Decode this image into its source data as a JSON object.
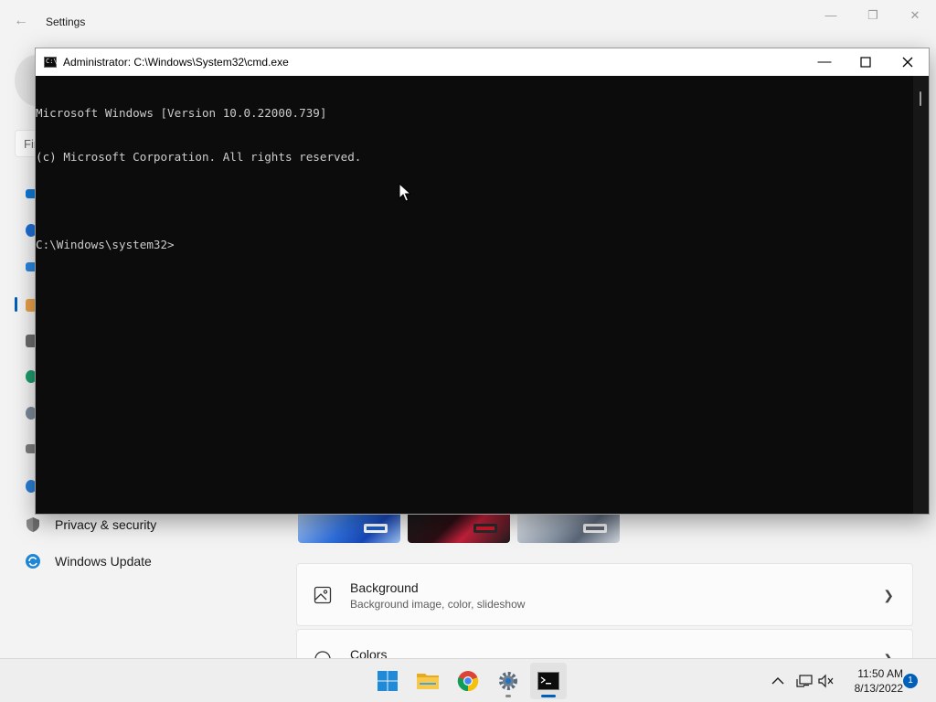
{
  "settings": {
    "title": "Settings",
    "find_placeholder": "Find a setting",
    "nav": [
      {
        "label": "Privacy & security",
        "icon": "shield-icon"
      },
      {
        "label": "Windows Update",
        "icon": "windows-update-icon"
      }
    ],
    "cards": [
      {
        "title": "Background",
        "subtitle": "Background image, color, slideshow",
        "icon": "image-icon"
      },
      {
        "title": "Colors",
        "subtitle": "",
        "icon": "palette-icon"
      }
    ],
    "accent": "#005fb8"
  },
  "cmd": {
    "title": "Administrator: C:\\Windows\\System32\\cmd.exe",
    "icon_text": "C:\\_",
    "lines": [
      "Microsoft Windows [Version 10.0.22000.739]",
      "(c) Microsoft Corporation. All rights reserved.",
      "",
      "C:\\Windows\\system32>"
    ]
  },
  "taskbar": {
    "apps": [
      {
        "name": "start",
        "icon": "windows-start-icon"
      },
      {
        "name": "file-explorer",
        "icon": "folder-icon"
      },
      {
        "name": "chrome",
        "icon": "chrome-icon"
      },
      {
        "name": "settings",
        "icon": "gear-icon",
        "running": true
      },
      {
        "name": "command-prompt",
        "icon": "cmd-icon",
        "active": true
      }
    ],
    "time": "11:50 AM",
    "date": "8/13/2022",
    "notification_count": "1",
    "indicator_color": "#005fb8"
  }
}
